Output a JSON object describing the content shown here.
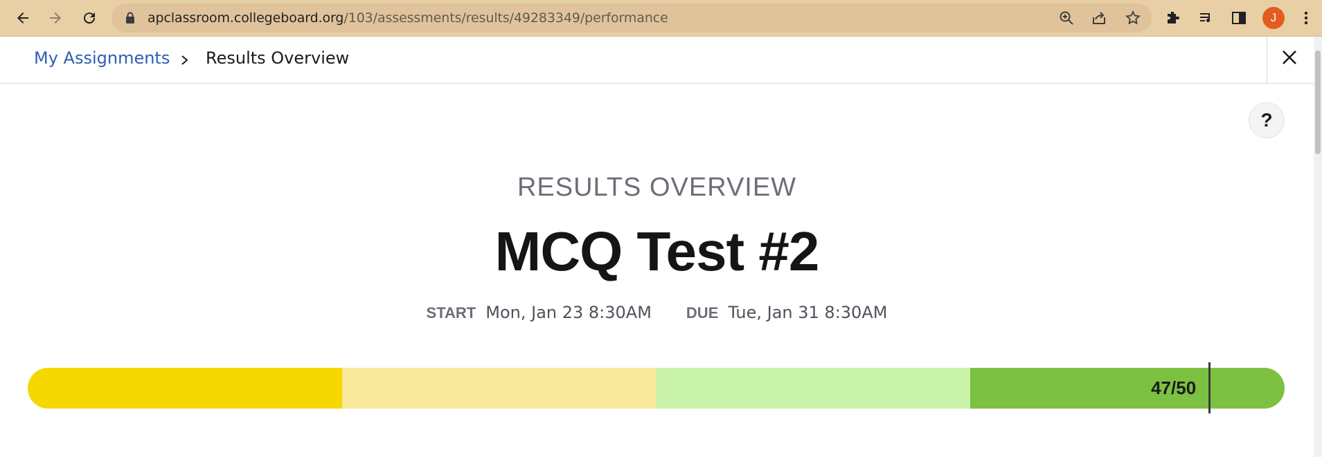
{
  "browser": {
    "url_host": "apclassroom.collegeboard.org",
    "url_path": "/103/assessments/results/49283349/performance",
    "avatar_initial": "J",
    "accent_color": "#e9cfa6"
  },
  "breadcrumb": {
    "link_label": "My Assignments",
    "current_label": "Results Overview"
  },
  "help": {
    "label": "?"
  },
  "results": {
    "eyebrow": "RESULTS OVERVIEW",
    "title": "MCQ Test #2",
    "start_label": "START",
    "start_value": "Mon, Jan 23 8:30AM",
    "due_label": "DUE",
    "due_value": "Tue, Jan 31 8:30AM"
  },
  "score": {
    "label": "47/50",
    "earned": 47,
    "total": 50,
    "bands": [
      {
        "color": "#f5d800"
      },
      {
        "color": "#f9e99b"
      },
      {
        "color": "#c8f3a8"
      },
      {
        "color": "#7cc142"
      }
    ]
  }
}
